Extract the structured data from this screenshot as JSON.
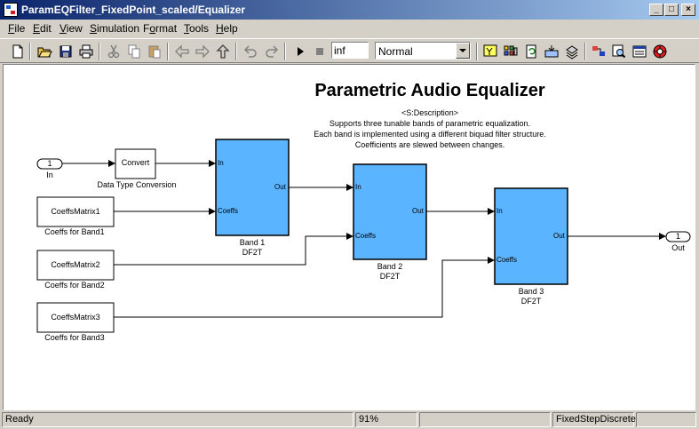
{
  "window": {
    "title": "ParamEQFilter_FixedPoint_scaled/Equalizer",
    "minimize": "_",
    "maximize": "□",
    "close": "×"
  },
  "menu": [
    {
      "pre": "",
      "ul": "F",
      "post": "ile"
    },
    {
      "pre": "",
      "ul": "E",
      "post": "dit"
    },
    {
      "pre": "",
      "ul": "V",
      "post": "iew"
    },
    {
      "pre": "",
      "ul": "S",
      "post": "imulation"
    },
    {
      "pre": "F",
      "ul": "o",
      "post": "rmat"
    },
    {
      "pre": "",
      "ul": "T",
      "post": "ools"
    },
    {
      "pre": "",
      "ul": "H",
      "post": "elp"
    }
  ],
  "toolbar": {
    "stop_time": "inf",
    "sim_mode": "Normal",
    "icons": [
      "new-file-icon",
      "open-folder-icon",
      "save-icon",
      "print-icon",
      "cut-icon",
      "copy-icon",
      "paste-icon",
      "back-icon",
      "forward-icon",
      "up-icon",
      "undo-icon",
      "redo-icon",
      "start-icon",
      "stop-icon",
      "build-icon",
      "library-icon",
      "update-icon",
      "debug-icon",
      "model-explorer-icon",
      "explorer-icon",
      "inspect-icon",
      "scope-icon",
      "settings-icon"
    ]
  },
  "diagram": {
    "title": "Parametric Audio Equalizer",
    "description": [
      "<S:Description>",
      "Supports three tunable bands of parametric equalization.",
      "Each band is implemented using a different biquad filter structure.",
      "Coefficients are slewed between changes."
    ],
    "inport": {
      "number": "1",
      "name": "In"
    },
    "outport": {
      "number": "1",
      "name": "Out"
    },
    "convert": {
      "text": "Convert",
      "name": "Data Type Conversion"
    },
    "coeffs": [
      {
        "text": "CoeffsMatrix1",
        "name": "Coeffs for Band1"
      },
      {
        "text": "CoeffsMatrix2",
        "name": "Coeffs for Band2"
      },
      {
        "text": "CoeffsMatrix3",
        "name": "Coeffs for Band3"
      }
    ],
    "bands": [
      {
        "in": "In",
        "coeffs": "Coeffs",
        "out": "Out",
        "name": "Band 1",
        "type": "DF2T"
      },
      {
        "in": "In",
        "coeffs": "Coeffs",
        "out": "Out",
        "name": "Band 2",
        "type": "DF2T"
      },
      {
        "in": "In",
        "coeffs": "Coeffs",
        "out": "Out",
        "name": "Band 3",
        "type": "DF2T"
      }
    ],
    "colors": {
      "subsystem": "#5bb4ff"
    }
  },
  "status": {
    "state": "Ready",
    "zoom": "91%",
    "solver": "FixedStepDiscrete"
  }
}
